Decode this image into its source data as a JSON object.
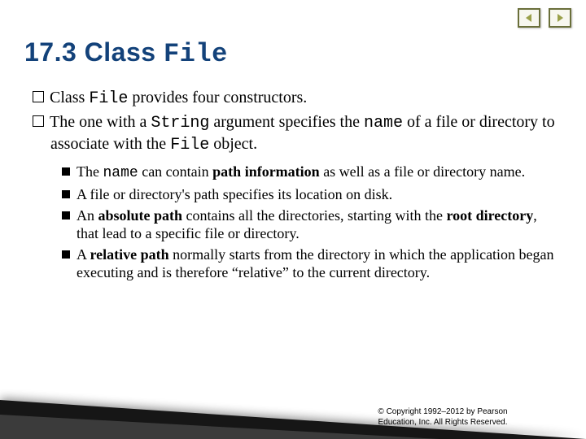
{
  "nav": {
    "prev_name": "prev-slide-button",
    "next_name": "next-slide-button"
  },
  "heading": {
    "num": "17.3",
    "word": "Class",
    "code": "File"
  },
  "primary": [
    {
      "pre": "Class ",
      "code1": "File",
      "mid": " provides four constructors."
    },
    {
      "pre": "The one with a ",
      "code1": "String",
      "mid": " argument specifies the ",
      "code2": "name",
      "post": " of a file or directory to associate with the ",
      "code3": "File",
      "tail": " object."
    }
  ],
  "sub": [
    {
      "t1": "The ",
      "code1": "name",
      "t2": " can contain ",
      "b1": "path information",
      "t3": " as well as a file or directory name."
    },
    {
      "t1": "A file or directory's path specifies its location on disk."
    },
    {
      "t1": "An ",
      "b1": "absolute path",
      "t2": " contains all the directories, starting with the ",
      "b2": "root directory",
      "t3": ", that lead to a specific file or directory."
    },
    {
      "t1": "A ",
      "b1": "relative path",
      "t2": " normally starts from the directory in which the application began executing and is therefore “relative” to the current directory."
    }
  ],
  "footer": {
    "line1": "© Copyright 1992–2012 by Pearson",
    "line2": "Education, Inc. All Rights Reserved."
  }
}
